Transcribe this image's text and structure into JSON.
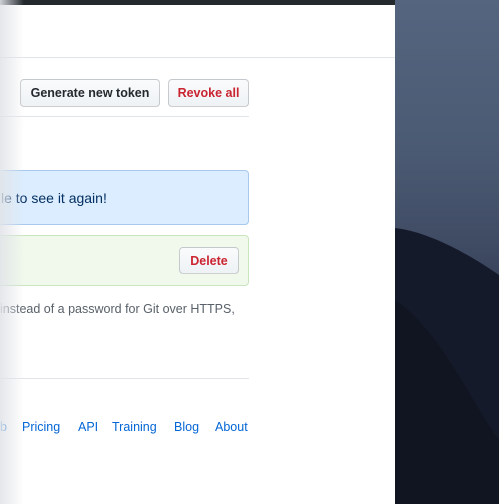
{
  "toolbar": {
    "generate_label": "Generate new token",
    "revoke_all_label": "Revoke all"
  },
  "flash": {
    "message": "le to see it again!"
  },
  "token": {
    "delete_label": "Delete"
  },
  "help": {
    "text": "instead of a password for Git over HTTPS,"
  },
  "footer": {
    "links": [
      "b",
      "Pricing",
      "API",
      "Training",
      "Blog",
      "About"
    ]
  },
  "colors": {
    "link": "#0366d6",
    "danger": "#cb2431",
    "info_bg": "#dbedff",
    "success_bg": "#f0f9ec"
  }
}
